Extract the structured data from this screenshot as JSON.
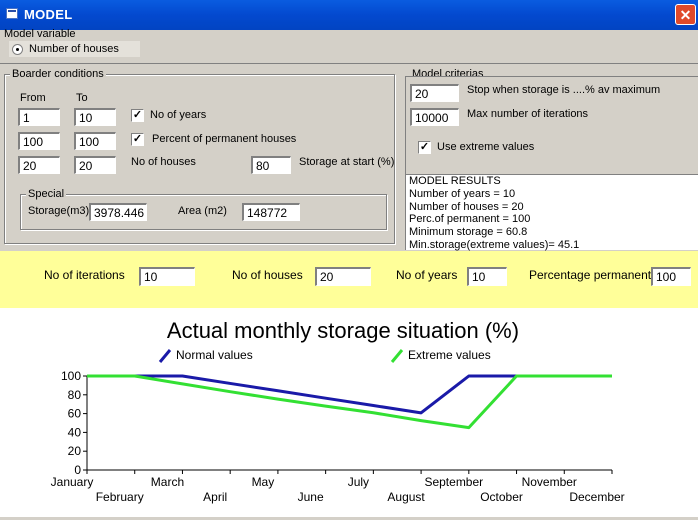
{
  "window": {
    "title": "MODEL",
    "close_glyph": "✕"
  },
  "model_variable": {
    "label": "Model variable",
    "selected": "Number of houses"
  },
  "border_conditions": {
    "label": "Boarder conditions",
    "from_label": "From",
    "to_label": "To",
    "rows": [
      {
        "from": "1",
        "to": "10",
        "checkbox_label": "No of years",
        "checked": "✓"
      },
      {
        "from": "100",
        "to": "100",
        "checkbox_label": "Percent of permanent houses",
        "checked": "✓"
      },
      {
        "from": "20",
        "to": "20",
        "label": "No of houses"
      }
    ],
    "storage_start_label": "Storage at start (%)",
    "storage_start_value": "80",
    "special": {
      "label": "Special",
      "storage_label": "Storage(m3)",
      "storage_value": "3978.446",
      "area_label": "Area (m2)",
      "area_value": "148772"
    }
  },
  "model_criteria": {
    "label": "Model criterias",
    "stop_value": "20",
    "stop_label": "Stop when storage is ....% av maximum",
    "max_iter_value": "10000",
    "max_iter_label": "Max number of iterations",
    "extreme_label": "Use extreme values",
    "extreme_checked": "✓"
  },
  "results": {
    "lines": [
      "MODEL RESULTS",
      "Number of years =   10",
      "Number of houses =   20",
      "Perc.of permanent =  100",
      "Minimum storage  =   60.8",
      "Min.storage(extreme values)=   45.1"
    ]
  },
  "summary_bar": {
    "iterations_label": "No of iterations",
    "iterations_value": "10",
    "houses_label": "No of houses",
    "houses_value": "20",
    "years_label": "No of years",
    "years_value": "10",
    "percentage_label": "Percentage permanent",
    "percentage_value": "100"
  },
  "chart_data": {
    "type": "line",
    "title": "Actual monthly storage situation (%)",
    "categories": [
      "January",
      "February",
      "March",
      "April",
      "May",
      "June",
      "July",
      "August",
      "September",
      "October",
      "November",
      "December"
    ],
    "series": [
      {
        "name": "Normal values",
        "color": "#1a1aa8",
        "values": [
          100,
          100,
          100,
          92.1,
          84.3,
          76.4,
          68.6,
          60.8,
          100,
          100,
          100,
          100
        ]
      },
      {
        "name": "Extreme values",
        "color": "#33e033",
        "values": [
          100,
          100,
          91.6,
          83.3,
          75.4,
          68.0,
          60.9,
          52.5,
          45.1,
          100,
          100,
          100
        ]
      }
    ],
    "ylim": [
      0,
      100
    ],
    "yticks": [
      "0",
      "20",
      "40",
      "60",
      "80",
      "100"
    ],
    "legend_position": "top"
  }
}
